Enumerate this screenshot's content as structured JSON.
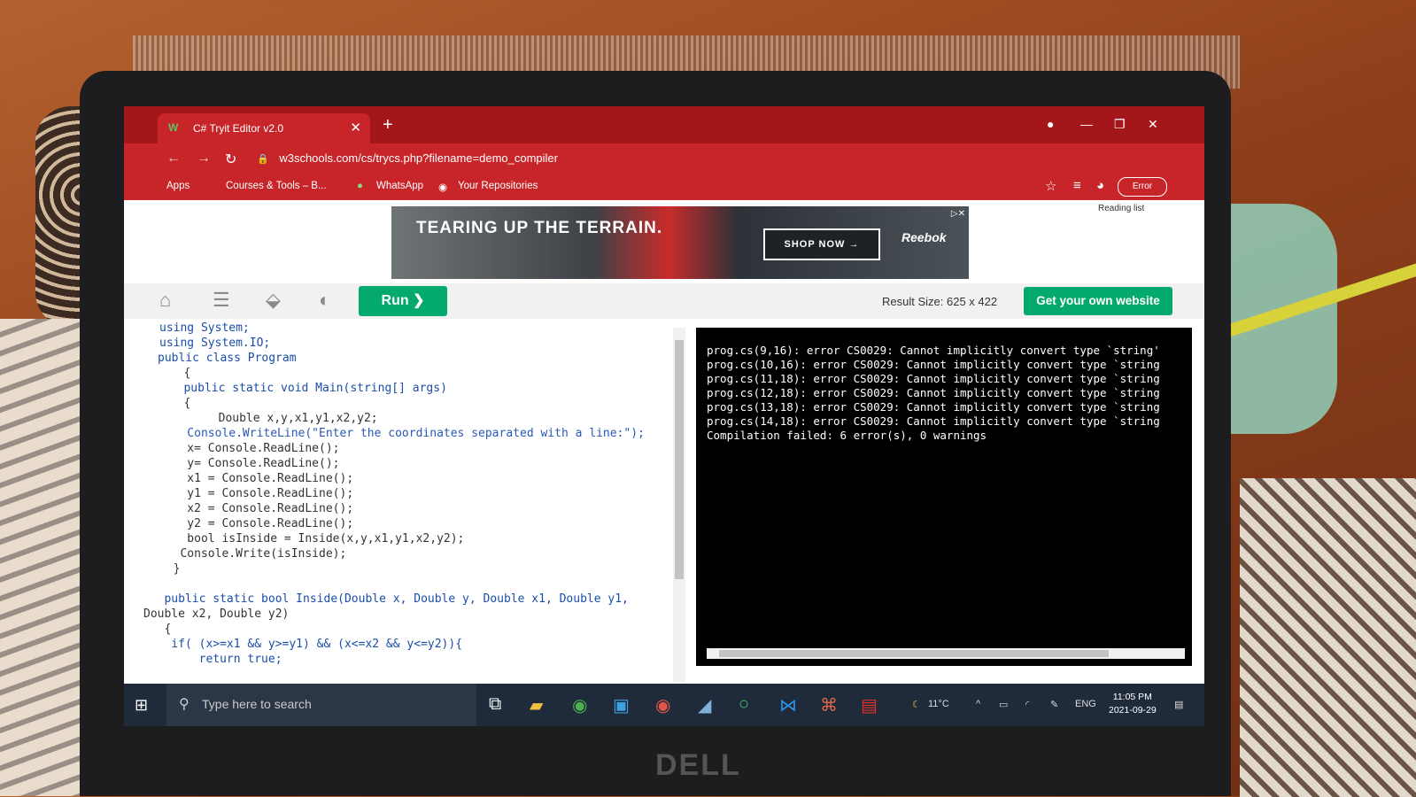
{
  "browser": {
    "tab_title": "C# Tryit Editor v2.0",
    "tab_close": "✕",
    "new_tab": "+",
    "url": "w3schools.com/cs/trycs.php?filename=demo_compiler",
    "bookmarks": [
      "Apps",
      "Courses & Tools – B...",
      "WhatsApp",
      "Your Repositories"
    ],
    "profile_status": "Error",
    "reading_list": "Reading list"
  },
  "ad": {
    "headline": "TEARING UP THE TERRAIN.",
    "cta": "SHOP NOW →",
    "brand": "Reebok"
  },
  "toolbar": {
    "run_label": "Run ❯",
    "result_size_label": "Result Size:",
    "result_size_value": "625 x 422",
    "get_website_label": "Get your own website"
  },
  "code": {
    "lines": [
      "using System;",
      "using System.IO;",
      "public class Program",
      "   {",
      "   public static void Main(string[] args)",
      "   {",
      "        Double x,y,x1,y1,x2,y2;",
      "    Console.WriteLine(\"Enter the coordinates separated with a line:\");",
      "    x= Console.ReadLine();",
      "    y= Console.ReadLine();",
      "    x1 = Console.ReadLine();",
      "    y1 = Console.ReadLine();",
      "    x2 = Console.ReadLine();",
      "    y2 = Console.ReadLine();",
      "    bool isInside = Inside(x,y,x1,y1,x2,y2);",
      "   Console.Write(isInside);",
      "  }",
      "",
      "   public static bool Inside(Double x, Double y, Double x1, Double y1,",
      "Double x2, Double y2)",
      "   {",
      "    if( (x>=x1 && y>=y1) && (x<=x2 && y<=y2)){",
      "        return true;"
    ]
  },
  "result": {
    "lines": [
      "prog.cs(9,16): error CS0029: Cannot implicitly convert type `string'",
      "prog.cs(10,16): error CS0029: Cannot implicitly convert type `string",
      "prog.cs(11,18): error CS0029: Cannot implicitly convert type `string",
      "prog.cs(12,18): error CS0029: Cannot implicitly convert type `string",
      "prog.cs(13,18): error CS0029: Cannot implicitly convert type `string",
      "prog.cs(14,18): error CS0029: Cannot implicitly convert type `string",
      "Compilation failed: 6 error(s), 0 warnings"
    ]
  },
  "taskbar": {
    "search_placeholder": "Type here to search",
    "weather": "11°C",
    "language": "ENG",
    "time": "11:05 PM",
    "date": "2021-09-29"
  },
  "laptop_brand": "DELL"
}
